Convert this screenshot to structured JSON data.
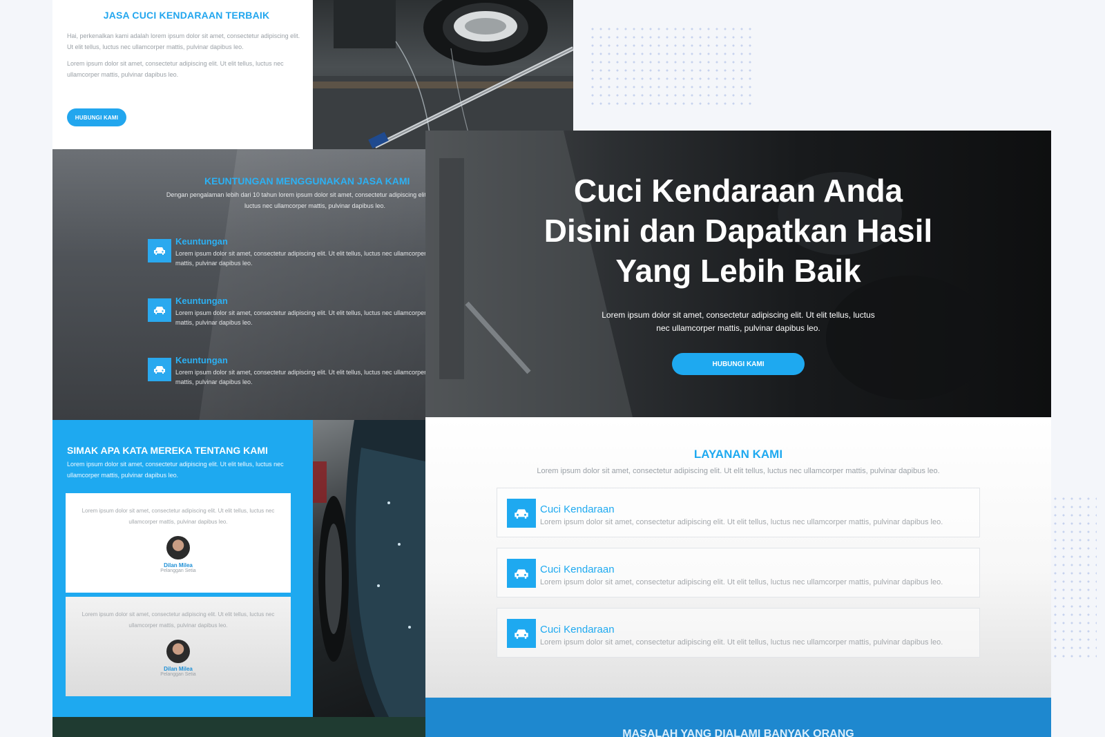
{
  "about": {
    "title": "JASA CUCI KENDARAAN TERBAIK",
    "para1": "Hai, perkenalkan kami adalah lorem ipsum dolor sit amet, consectetur adipiscing elit. Ut elit tellus, luctus nec ullamcorper mattis, pulvinar dapibus leo.",
    "para2": "Lorem ipsum dolor sit amet, consectetur adipiscing elit. Ut elit tellus, luctus nec ullamcorper mattis, pulvinar dapibus leo.",
    "button": "HUBUNGI KAMI"
  },
  "benefits": {
    "title": "KEUNTUNGAN MENGGUNAKAN JASA KAMI",
    "subtitle": "Dengan pengalaman lebih dari 10 tahun lorem ipsum dolor sit amet, consectetur adipiscing elit. Ut elit tellus, luctus nec ullamcorper mattis, pulvinar dapibus leo.",
    "items": [
      {
        "title": "Keuntungan",
        "text": "Lorem ipsum dolor sit amet, consectetur adipiscing elit. Ut elit tellus, luctus nec ullamcorper mattis, pulvinar dapibus leo.",
        "icon": "car-icon"
      },
      {
        "title": "Keuntungan",
        "text": "Lorem ipsum dolor sit amet, consectetur adipiscing elit. Ut elit tellus, luctus nec ullamcorper mattis, pulvinar dapibus leo.",
        "icon": "car-icon"
      },
      {
        "title": "Keuntungan",
        "text": "Lorem ipsum dolor sit amet, consectetur adipiscing elit. Ut elit tellus, luctus nec ullamcorper mattis, pulvinar dapibus leo.",
        "icon": "car-icon"
      }
    ]
  },
  "testimonials": {
    "title": "SIMAK APA KATA MEREKA TENTANG KAMI",
    "subtitle": "Lorem ipsum dolor sit amet, consectetur adipiscing elit. Ut elit tellus, luctus nec ullamcorper mattis, pulvinar dapibus leo.",
    "items": [
      {
        "text": "Lorem ipsum dolor sit amet, consectetur adipiscing elit. Ut elit tellus, luctus nec ullamcorper mattis, pulvinar dapibus leo.",
        "name": "Dilan Milea",
        "role": "Pelanggan Setia"
      },
      {
        "text": "Lorem ipsum dolor sit amet, consectetur adipiscing elit. Ut elit tellus, luctus nec ullamcorper mattis, pulvinar dapibus leo.",
        "name": "Dilan Milea",
        "role": "Pelanggan Setia"
      }
    ]
  },
  "hero": {
    "title_line1": "Cuci Kendaraan Anda",
    "title_line2": "Disini dan Dapatkan Hasil",
    "title_line3": "Yang Lebih Baik",
    "subtitle": "Lorem ipsum dolor sit amet, consectetur adipiscing elit. Ut elit tellus, luctus nec ullamcorper mattis, pulvinar dapibus leo.",
    "button": "HUBUNGI KAMI"
  },
  "services": {
    "title": "LAYANAN KAMI",
    "subtitle": "Lorem ipsum dolor sit amet, consectetur adipiscing elit. Ut elit tellus, luctus nec ullamcorper mattis, pulvinar dapibus leo.",
    "items": [
      {
        "title": "Cuci Kendaraan",
        "text": "Lorem ipsum dolor sit amet, consectetur adipiscing elit. Ut elit tellus, luctus nec ullamcorper mattis, pulvinar dapibus leo.",
        "icon": "car-icon"
      },
      {
        "title": "Cuci Kendaraan",
        "text": "Lorem ipsum dolor sit amet, consectetur adipiscing elit. Ut elit tellus, luctus nec ullamcorper mattis, pulvinar dapibus leo.",
        "icon": "car-icon"
      },
      {
        "title": "Cuci Kendaraan",
        "text": "Lorem ipsum dolor sit amet, consectetur adipiscing elit. Ut elit tellus, luctus nec ullamcorper mattis, pulvinar dapibus leo.",
        "icon": "car-icon"
      }
    ]
  },
  "problems": {
    "title": "MASALAH YANG DIALAMI BANYAK ORANG"
  },
  "colors": {
    "accent": "#1ea9f0",
    "page_background": "#f4f6fa"
  }
}
